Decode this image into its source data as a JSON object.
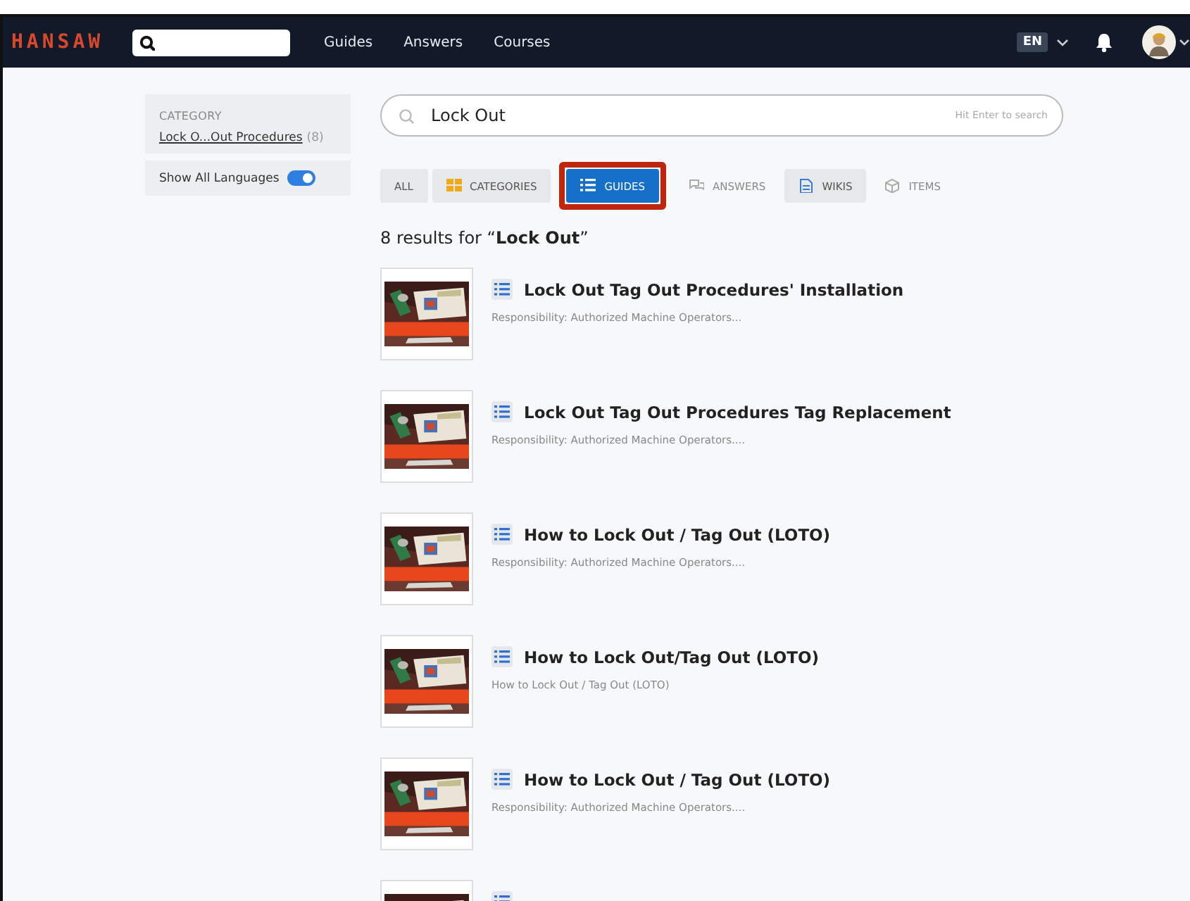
{
  "navbar": {
    "logo": "HANSAW",
    "links": [
      "Guides",
      "Answers",
      "Courses"
    ],
    "language": "EN"
  },
  "sidebar": {
    "category_heading": "CATEGORY",
    "category": {
      "label": "Lock O...Out Procedures",
      "count": "(8)"
    },
    "show_all_languages": {
      "label": "Show All Languages",
      "on": true
    }
  },
  "search": {
    "value": "Lock Out",
    "hint": "Hit Enter to search"
  },
  "filters": [
    {
      "label": "ALL",
      "kind": "plain",
      "selected": false,
      "disabled": false,
      "highlighted": false
    },
    {
      "label": "CATEGORIES",
      "kind": "categories",
      "selected": false,
      "disabled": false,
      "highlighted": false
    },
    {
      "label": "GUIDES",
      "kind": "guides",
      "selected": true,
      "disabled": false,
      "highlighted": true
    },
    {
      "label": "ANSWERS",
      "kind": "answers",
      "selected": false,
      "disabled": true,
      "highlighted": false
    },
    {
      "label": "WIKIS",
      "kind": "wikis",
      "selected": false,
      "disabled": false,
      "highlighted": false
    },
    {
      "label": "ITEMS",
      "kind": "items",
      "selected": false,
      "disabled": true,
      "highlighted": false
    }
  ],
  "results_heading": "8 results for “**Lock Out**”",
  "results": [
    {
      "kind": "full",
      "title": "Lock Out Tag Out Procedures' Installation",
      "summary": "Responsibility: Authorized Machine Operators..."
    },
    {
      "kind": "full",
      "title": "Lock Out Tag Out Procedures Tag Replacement",
      "summary": "Responsibility: Authorized Machine Operators...."
    },
    {
      "kind": "full",
      "title": "How to Lock Out / Tag Out (LOTO)",
      "summary": "Responsibility: Authorized Machine Operators...."
    },
    {
      "kind": "full",
      "title": "How to Lock Out/Tag Out (LOTO)",
      "summary": "How to Lock Out / Tag Out (LOTO)"
    },
    {
      "kind": "full",
      "title": "How to Lock Out / Tag Out (LOTO)",
      "summary": "Responsibility: Authorized Machine Operators...."
    },
    {
      "kind": "cut_off"
    }
  ]
}
